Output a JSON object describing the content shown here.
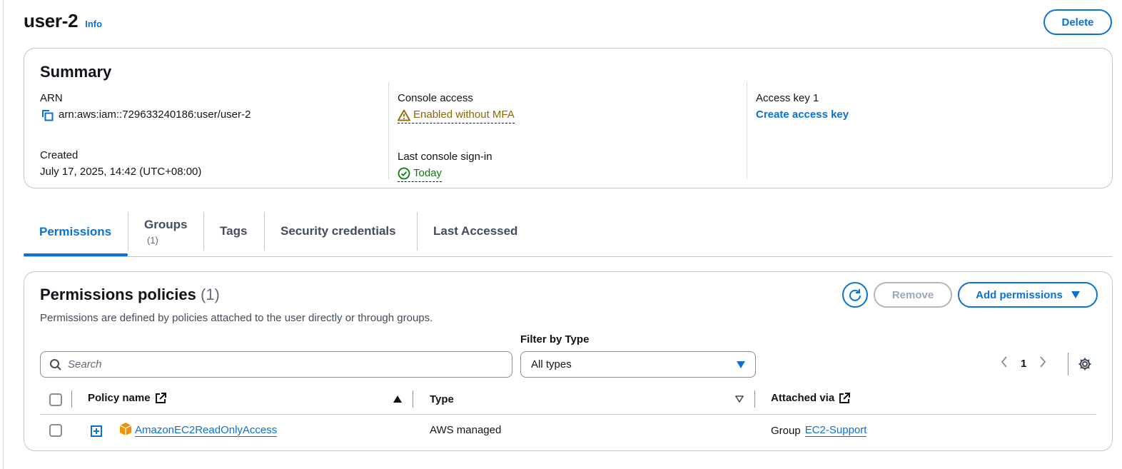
{
  "header": {
    "title": "user-2",
    "info_label": "Info",
    "delete_label": "Delete"
  },
  "summary": {
    "title": "Summary",
    "arn_label": "ARN",
    "arn_value": "arn:aws:iam::729633240186:user/user-2",
    "created_label": "Created",
    "created_value": "July 17, 2025, 14:42 (UTC+08:00)",
    "console_access_label": "Console access",
    "console_access_value": "Enabled without MFA",
    "last_signin_label": "Last console sign-in",
    "last_signin_value": "Today",
    "access_key_label": "Access key 1",
    "access_key_action": "Create access key"
  },
  "tabs": [
    {
      "label": "Permissions",
      "count": ""
    },
    {
      "label": "Groups",
      "count": "(1)"
    },
    {
      "label": "Tags",
      "count": ""
    },
    {
      "label": "Security credentials",
      "count": ""
    },
    {
      "label": "Last Accessed",
      "count": ""
    }
  ],
  "policies": {
    "title": "Permissions policies",
    "count": "(1)",
    "description": "Permissions are defined by policies attached to the user directly or through groups.",
    "remove_label": "Remove",
    "add_label": "Add permissions",
    "filter_label": "Filter by Type",
    "search_placeholder": "Search",
    "filter_value": "All types",
    "page": "1",
    "columns": {
      "policy_name": "Policy name",
      "type": "Type",
      "attached_via": "Attached via"
    },
    "rows": [
      {
        "policy_name": "AmazonEC2ReadOnlyAccess",
        "type": "AWS managed",
        "attached_prefix": "Group",
        "attached_link": "EC2-Support"
      }
    ]
  },
  "colors": {
    "accent": "#0972d3",
    "warning": "#8d6605",
    "success": "#037f0c",
    "policy_icon": "#f29100"
  }
}
